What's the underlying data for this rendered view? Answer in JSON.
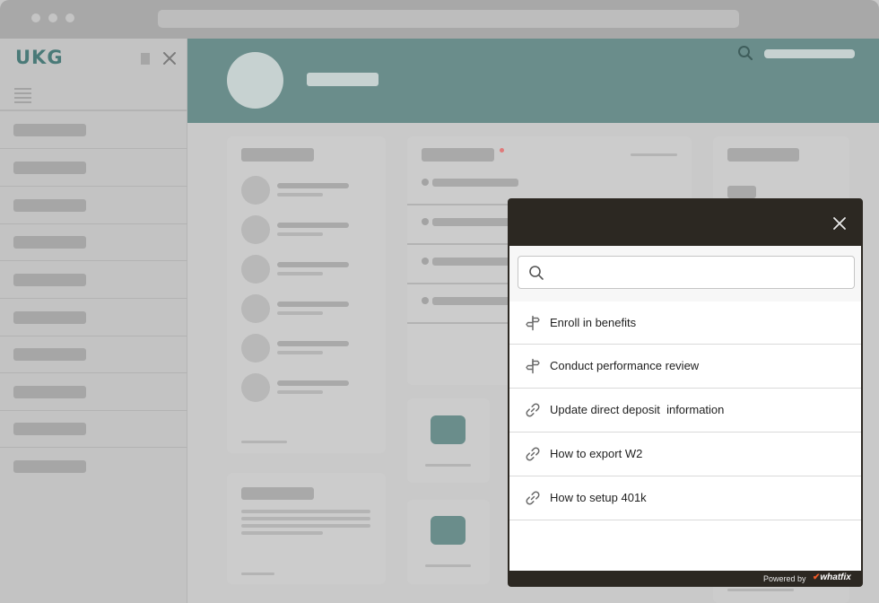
{
  "app": {
    "logo_text": "UKG",
    "brand_color": "#6a8d8b"
  },
  "sidebar": {
    "menu_icon": "hamburger-icon",
    "close_icon": "close-icon",
    "item_count": 10
  },
  "header": {
    "search_icon": "search-icon"
  },
  "popup": {
    "close_icon": "close-icon",
    "search": {
      "placeholder": "",
      "value": "",
      "icon": "search-icon"
    },
    "items": [
      {
        "label": "Enroll in benefits",
        "icon": "signpost-icon"
      },
      {
        "label": "Conduct performance review",
        "icon": "signpost-icon"
      },
      {
        "label": "Update direct deposit  information",
        "icon": "link-icon"
      },
      {
        "label": "How to export W2",
        "icon": "link-icon"
      },
      {
        "label": "How to setup 401k",
        "icon": "link-icon"
      }
    ],
    "footer": {
      "powered_by": "Powered by",
      "brand": "whatfix",
      "brand_color": "#f05a28"
    }
  }
}
